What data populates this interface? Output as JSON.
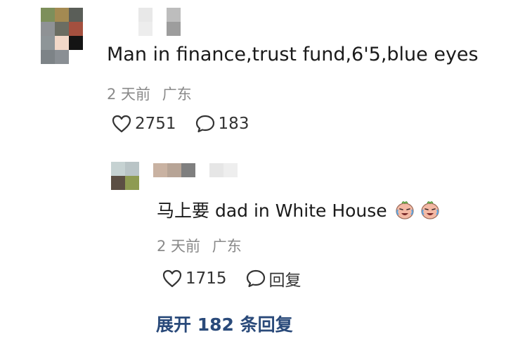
{
  "comment": {
    "text": "Man in finance,trust fund,6'5,blue eyes",
    "time": "2 天前",
    "location": "广东",
    "likes": "2751",
    "replies": "183"
  },
  "reply": {
    "text": "马上要 dad in White House",
    "emoji_icons": [
      "crying-laughing-face-icon",
      "crying-laughing-face-icon"
    ],
    "time": "2 天前",
    "location": "广东",
    "likes": "1715",
    "reply_label": "回复"
  },
  "expand_replies": "展开 182 条回复",
  "colors": {
    "text_primary": "#1a1a1a",
    "text_meta": "#8a8a8a",
    "link": "#2a4a7a"
  }
}
